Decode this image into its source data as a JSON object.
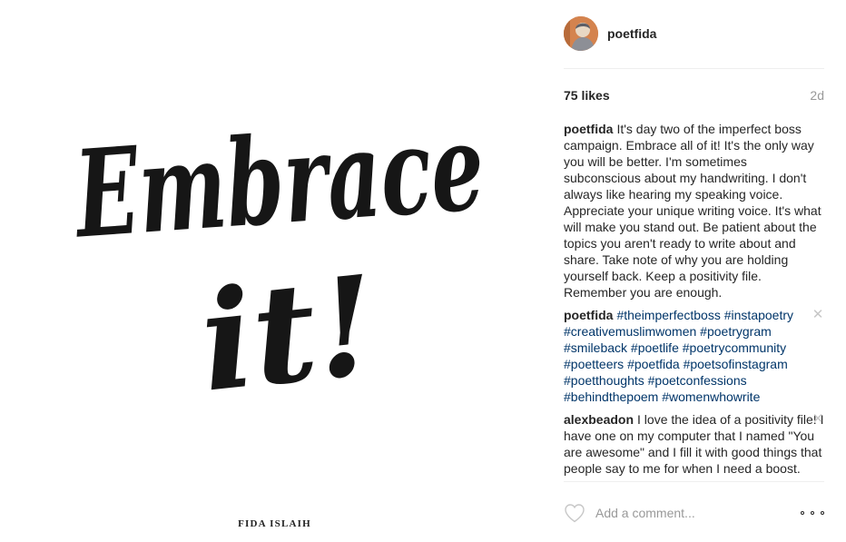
{
  "post_image": {
    "headline_line1": "Embrace",
    "headline_line2": "it!",
    "credit": "FIDA ISLAIH"
  },
  "header": {
    "username": "poetfida"
  },
  "stats": {
    "likes": "75 likes",
    "age": "2d"
  },
  "caption": {
    "user": "poetfida",
    "text": "It's day two of the imperfect boss campaign. Embrace all of it! It's the only way you will be better. I'm sometimes subconscious about my handwriting. I don't always like hearing my speaking voice. Appreciate your unique writing voice. It's what will make you stand out. Be patient about the topics you aren't ready to write about and share. Take note of why you are holding yourself back. Keep a positivity file. Remember you are enough."
  },
  "comments": [
    {
      "user": "poetfida",
      "hashtags": [
        "#theimperfectboss",
        "#instapoetry",
        "#creativemuslimwomen",
        "#poetrygram",
        "#smileback",
        "#poetlife",
        "#poetrycommunity",
        "#poetteers",
        "#poetfida",
        "#poetsofinstagram",
        "#poetthoughts",
        "#poetconfessions",
        "#behindthepoem",
        "#womenwhowrite"
      ]
    },
    {
      "user": "alexbeadon",
      "text": "I love the idea of a positivity file! I have one on my computer that I named \"You are awesome\" and I fill it with good things that people say to me for when I need a boost."
    }
  ],
  "icons": {
    "like": "heart-outline-icon",
    "more": "more-options-icon",
    "remove": "close-icon"
  },
  "comment_box": {
    "placeholder": "Add a comment..."
  },
  "colors": {
    "hashtag": "#003569",
    "muted": "#999999",
    "text": "#262626"
  }
}
